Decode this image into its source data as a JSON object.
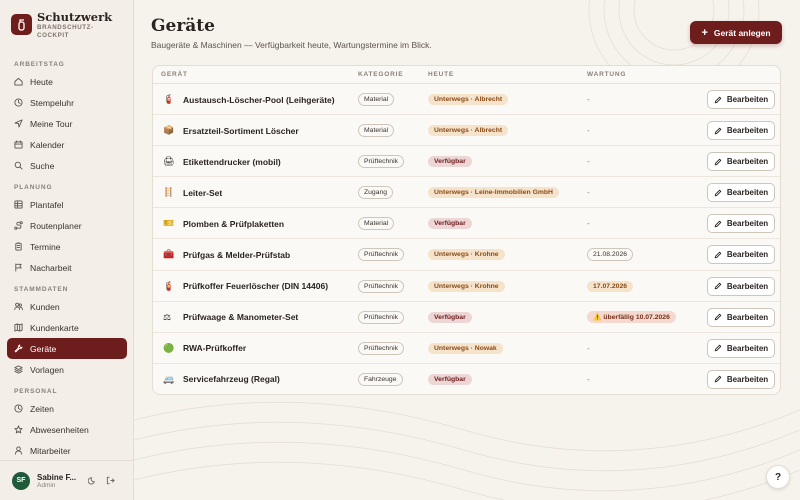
{
  "brand": {
    "title": "Schutzwerk",
    "subtitle": "BRANDSCHUTZ-COCKPIT"
  },
  "sidebar": {
    "sections": [
      {
        "label": "ARBEITSTAG",
        "items": [
          {
            "label": "Heute",
            "icon": "home-icon"
          },
          {
            "label": "Stempeluhr",
            "icon": "clock-icon"
          },
          {
            "label": "Meine Tour",
            "icon": "navigation-icon"
          },
          {
            "label": "Kalender",
            "icon": "calendar-icon"
          },
          {
            "label": "Suche",
            "icon": "search-icon"
          }
        ]
      },
      {
        "label": "PLANUNG",
        "items": [
          {
            "label": "Plantafel",
            "icon": "grid-icon"
          },
          {
            "label": "Routenplaner",
            "icon": "route-icon"
          },
          {
            "label": "Termine",
            "icon": "clipboard-icon"
          },
          {
            "label": "Nacharbeit",
            "icon": "flag-icon"
          }
        ]
      },
      {
        "label": "STAMMDATEN",
        "items": [
          {
            "label": "Kunden",
            "icon": "users-icon"
          },
          {
            "label": "Kundenkarte",
            "icon": "map-icon"
          },
          {
            "label": "Geräte",
            "icon": "wrench-icon",
            "active": true
          },
          {
            "label": "Vorlagen",
            "icon": "layers-icon"
          }
        ]
      },
      {
        "label": "PERSONAL",
        "items": [
          {
            "label": "Zeiten",
            "icon": "clock-icon"
          },
          {
            "label": "Abwesenheiten",
            "icon": "star-icon"
          },
          {
            "label": "Mitarbeiter",
            "icon": "user-icon"
          }
        ]
      }
    ]
  },
  "user": {
    "initials": "SF",
    "name": "Sabine F...",
    "role": "Admin"
  },
  "page": {
    "title": "Geräte",
    "subtitle": "Baugeräte & Maschinen — Verfügbarkeit heute, Wartungstermine im Blick.",
    "add_label": "Gerät anlegen"
  },
  "table": {
    "headers": {
      "name": "GERÄT",
      "category": "KATEGORIE",
      "today": "HEUTE",
      "maintenance": "WARTUNG"
    },
    "action_label": "Bearbeiten",
    "rows": [
      {
        "icon": "🧯",
        "name": "Austausch-Löscher-Pool (Leihgeräte)",
        "category": "Material",
        "today": "Unterwegs · Albrecht",
        "status": "away",
        "maintenance": "-",
        "mstate": "none"
      },
      {
        "icon": "📦",
        "name": "Ersatzteil-Sortiment Löscher",
        "category": "Material",
        "today": "Unterwegs · Albrecht",
        "status": "away",
        "maintenance": "-",
        "mstate": "none"
      },
      {
        "icon": "🖨",
        "name": "Etikettendrucker (mobil)",
        "category": "Prüftechnik",
        "today": "Verfügbar",
        "status": "avail",
        "maintenance": "-",
        "mstate": "none"
      },
      {
        "icon": "🪜",
        "name": "Leiter-Set",
        "category": "Zugang",
        "today": "Unterwegs · Leine-Immobilien GmbH",
        "status": "away",
        "maintenance": "-",
        "mstate": "none"
      },
      {
        "icon": "🎫",
        "name": "Plomben & Prüfplaketten",
        "category": "Material",
        "today": "Verfügbar",
        "status": "avail",
        "maintenance": "-",
        "mstate": "none"
      },
      {
        "icon": "🧰",
        "name": "Prüfgas & Melder-Prüfstab",
        "category": "Prüftechnik",
        "today": "Unterwegs · Krohne",
        "status": "away",
        "maintenance": "21.08.2026",
        "mstate": "date"
      },
      {
        "icon": "🧯",
        "name": "Prüfkoffer Feuerlöscher (DIN 14406)",
        "category": "Prüftechnik",
        "today": "Unterwegs · Krohne",
        "status": "away",
        "maintenance": "17.07.2026",
        "mstate": "soon"
      },
      {
        "icon": "⚖",
        "name": "Prüfwaage & Manometer-Set",
        "category": "Prüftechnik",
        "today": "Verfügbar",
        "status": "avail",
        "maintenance": "⚠️ überfällig 10.07.2026",
        "mstate": "over"
      },
      {
        "icon": "🟢",
        "name": "RWA-Prüfkoffer",
        "category": "Prüftechnik",
        "today": "Unterwegs · Nowak",
        "status": "away",
        "maintenance": "-",
        "mstate": "none"
      },
      {
        "icon": "🚐",
        "name": "Servicefahrzeug (Regal)",
        "category": "Fahrzeuge",
        "today": "Verfügbar",
        "status": "avail",
        "maintenance": "-",
        "mstate": "none"
      }
    ]
  },
  "help_label": "?"
}
